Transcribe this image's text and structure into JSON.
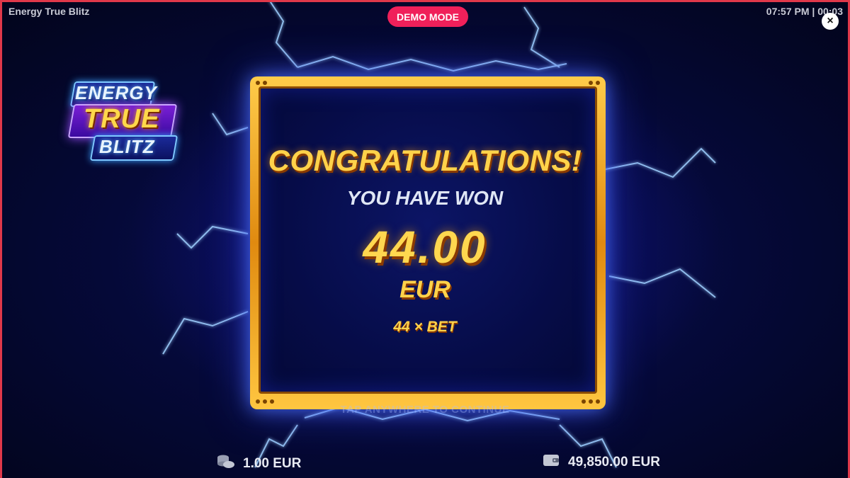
{
  "window": {
    "title": "Energy True Blitz",
    "clock": "07:57 PM | 00:03"
  },
  "badge": {
    "label": "DEMO MODE",
    "color": "#f0205a"
  },
  "close_button": {
    "label": "×"
  },
  "logo": {
    "line1": "ENERGY",
    "line2": "TRUE",
    "line3": "BLITZ"
  },
  "win_panel": {
    "headline": "CONGRATULATIONS!",
    "subtitle": "YOU HAVE WON",
    "amount": "44.00",
    "currency": "EUR",
    "multiplier": "44 × BET",
    "hint": "TAP ANYWHERE TO CONTINUE"
  },
  "footer": {
    "bet": {
      "icon": "coins-icon",
      "value": "1.00 EUR"
    },
    "balance": {
      "icon": "wallet-icon",
      "value": "49,850.00 EUR"
    }
  },
  "colors": {
    "gold": "#ffd24a",
    "frame": "#e0384a",
    "background": "#02041a"
  }
}
